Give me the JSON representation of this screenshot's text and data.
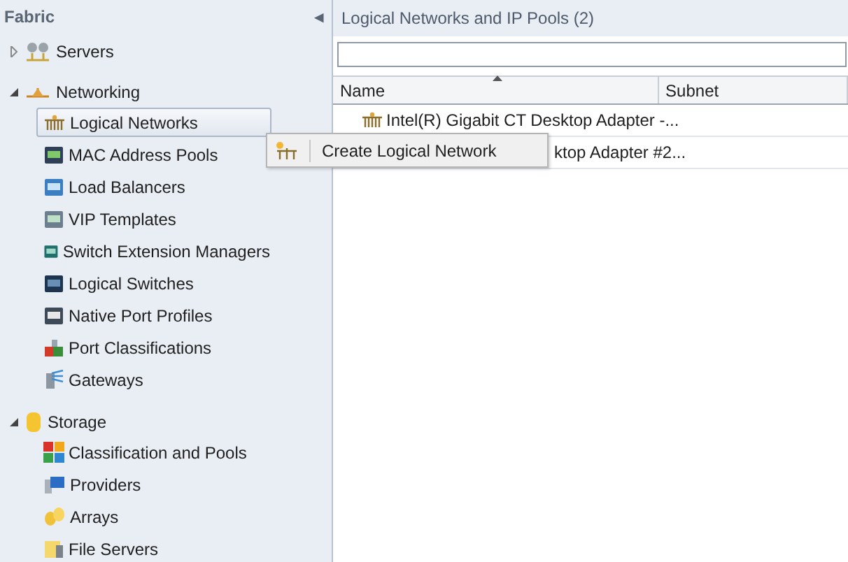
{
  "sidebar": {
    "title": "Fabric",
    "collapse_glyph": "◂",
    "groups": [
      {
        "label": "Servers",
        "expanded": false
      },
      {
        "label": "Networking",
        "expanded": true,
        "children": [
          {
            "label": "Logical Networks",
            "selected": true
          },
          {
            "label": "MAC Address Pools",
            "selected": false
          },
          {
            "label": "Load Balancers",
            "selected": false
          },
          {
            "label": "VIP Templates",
            "selected": false
          },
          {
            "label": "Switch Extension Managers",
            "selected": false
          },
          {
            "label": "Logical Switches",
            "selected": false
          },
          {
            "label": "Native Port Profiles",
            "selected": false
          },
          {
            "label": "Port Classifications",
            "selected": false
          },
          {
            "label": "Gateways",
            "selected": false
          }
        ]
      },
      {
        "label": "Storage",
        "expanded": true,
        "children": [
          {
            "label": "Classification and Pools",
            "selected": false
          },
          {
            "label": "Providers",
            "selected": false
          },
          {
            "label": "Arrays",
            "selected": false
          },
          {
            "label": "File Servers",
            "selected": false
          }
        ]
      }
    ]
  },
  "main": {
    "title": "Logical Networks and IP Pools (2)",
    "table": {
      "columns": [
        {
          "label": "Name",
          "sorted": true
        },
        {
          "label": "Subnet",
          "sorted": false
        }
      ],
      "rows": [
        {
          "name": "Intel(R) Gigabit CT Desktop Adapter -...",
          "covered": false
        },
        {
          "name": "ktop Adapter #2...",
          "covered": true
        }
      ]
    }
  },
  "context_menu": {
    "items": [
      {
        "label": "Create Logical Network"
      }
    ]
  }
}
